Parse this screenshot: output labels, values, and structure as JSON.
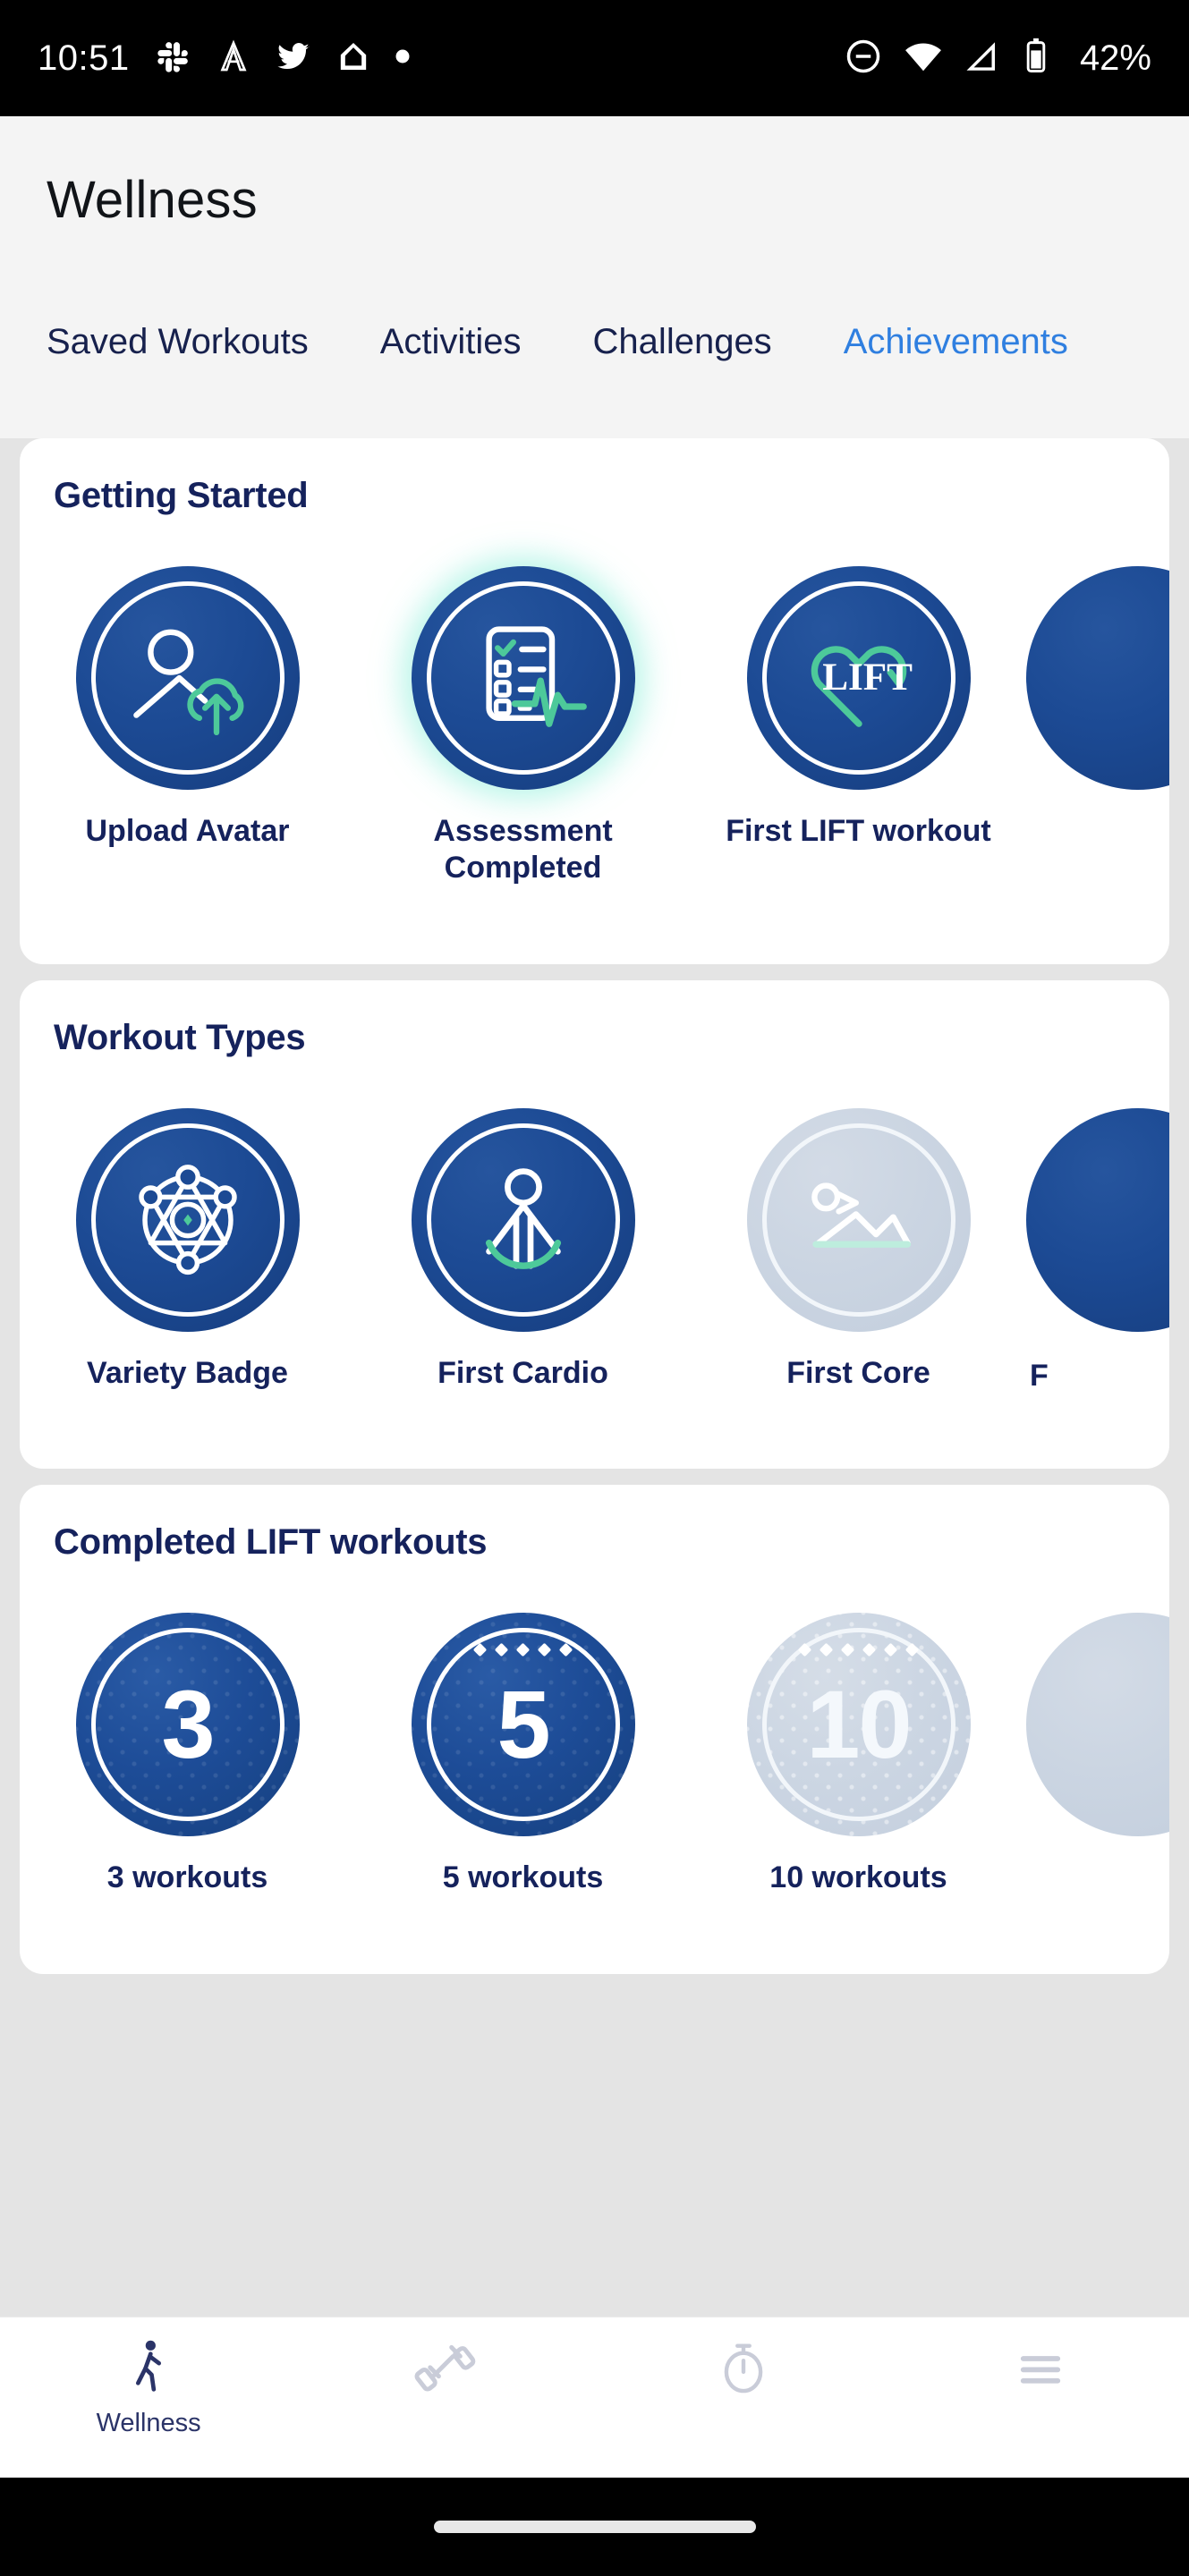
{
  "statusbar": {
    "clock": "10:51",
    "battery_percent": "42%",
    "left_icons": [
      "slack-icon",
      "adobe-acrobat-icon",
      "twitter-icon",
      "google-home-icon",
      "more-dot-icon"
    ],
    "right_icons": [
      "do-not-disturb-icon",
      "wifi-icon",
      "cellular-signal-icon",
      "battery-icon"
    ]
  },
  "header": {
    "title": "Wellness"
  },
  "tabs": [
    {
      "label": "Saved Workouts",
      "active": false
    },
    {
      "label": "Activities",
      "active": false
    },
    {
      "label": "Challenges",
      "active": false
    },
    {
      "label": "Achievements",
      "active": true
    }
  ],
  "sections": [
    {
      "title": "Getting Started",
      "badges": [
        {
          "label": "Upload Avatar",
          "icon": "upload-avatar-icon",
          "state": "earned",
          "glow": false
        },
        {
          "label": "Assessment Completed",
          "icon": "assessment-checklist-icon",
          "state": "earned",
          "glow": true
        },
        {
          "label": "First LIFT workout",
          "icon": "lift-heart-icon",
          "state": "earned",
          "glow": false
        }
      ],
      "peek": {
        "state": "earned",
        "label": ""
      }
    },
    {
      "title": "Workout Types",
      "badges": [
        {
          "label": "Variety Badge",
          "icon": "atom-variety-icon",
          "state": "earned",
          "glow": false
        },
        {
          "label": "First Cardio",
          "icon": "cardio-figure-icon",
          "state": "earned",
          "glow": false
        },
        {
          "label": "First Core",
          "icon": "core-plank-icon",
          "state": "locked",
          "glow": false
        }
      ],
      "peek": {
        "state": "earned",
        "label": "F"
      }
    },
    {
      "title": "Completed LIFT workouts",
      "badges": [
        {
          "label": "3 workouts",
          "number": "3",
          "state": "earned",
          "sparkles": 0
        },
        {
          "label": "5 workouts",
          "number": "5",
          "state": "earned",
          "sparkles": 5
        },
        {
          "label": "10 workouts",
          "number": "10",
          "state": "locked",
          "sparkles": 6
        }
      ],
      "peek": {
        "state": "locked",
        "label": ""
      }
    }
  ],
  "bottom_nav": [
    {
      "label": "Wellness",
      "icon": "walking-person-icon",
      "active": true
    },
    {
      "label": "",
      "icon": "dumbbell-icon",
      "active": false
    },
    {
      "label": "",
      "icon": "stopwatch-icon",
      "active": false
    },
    {
      "label": "",
      "icon": "hamburger-menu-icon",
      "active": false
    }
  ],
  "colors": {
    "brand_navy": "#15225c",
    "medal_blue": "#1c4a94",
    "accent_green": "#4dc99a",
    "active_tab_blue": "#2f7fe0",
    "locked_grey": "#cbd5e2",
    "page_bg": "#f4f4f4",
    "scroll_bg": "#e4e4e4"
  }
}
